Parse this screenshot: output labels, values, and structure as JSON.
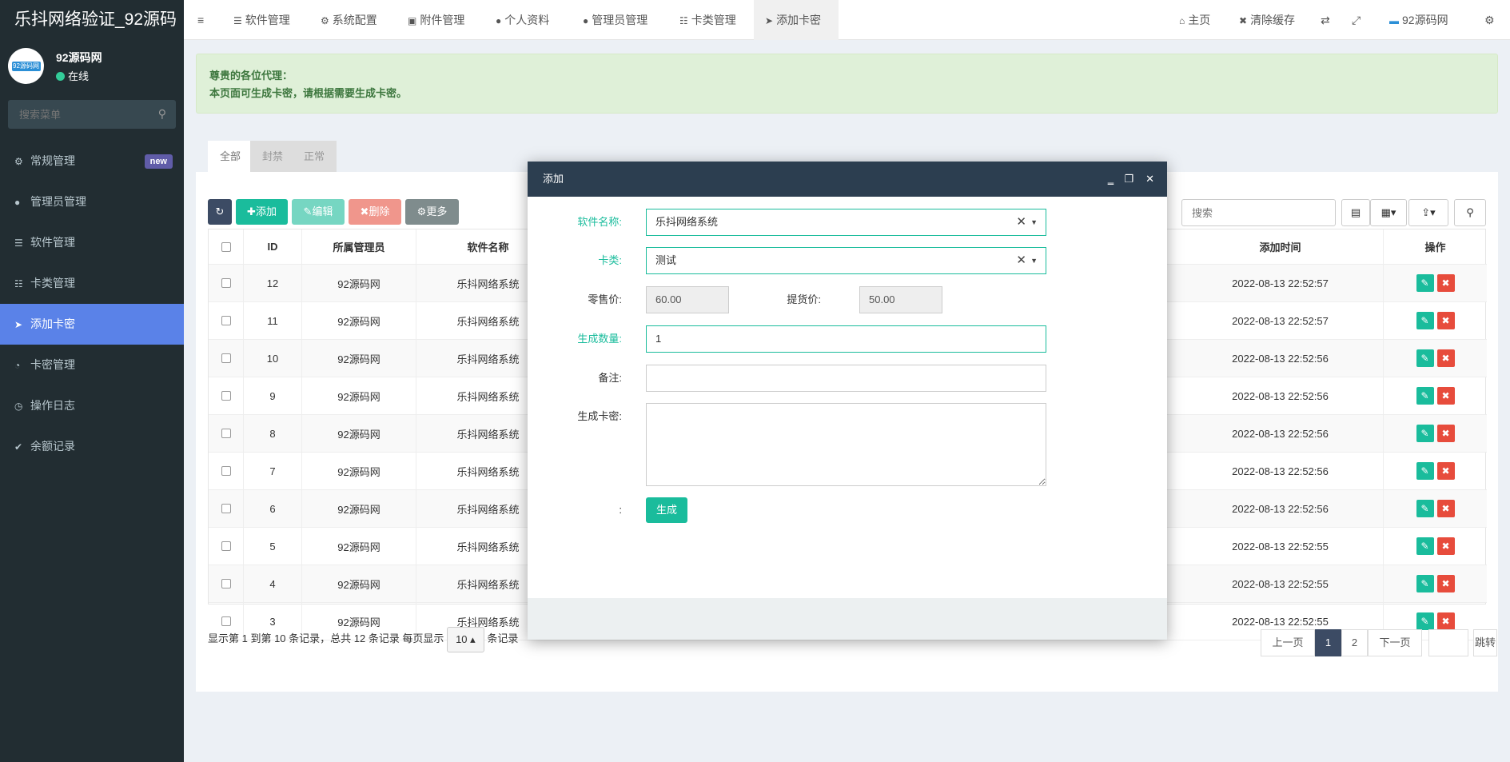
{
  "sidebar": {
    "brand": "乐抖网络验证_92源码",
    "avatar_text": "92源码网",
    "user_name": "92源码网",
    "user_status": "在线",
    "search_placeholder": "搜索菜单",
    "items": [
      {
        "label": "常规管理",
        "icon": "cogs-icon",
        "badge": "new"
      },
      {
        "label": "管理员管理",
        "icon": "user-icon"
      },
      {
        "label": "软件管理",
        "icon": "list-icon"
      },
      {
        "label": "卡类管理",
        "icon": "card-list-icon"
      },
      {
        "label": "添加卡密",
        "icon": "paper-plane-icon",
        "active": true
      },
      {
        "label": "卡密管理",
        "icon": "rss-icon"
      },
      {
        "label": "操作日志",
        "icon": "clock-icon"
      },
      {
        "label": "余额记录",
        "icon": "vimeo-icon"
      }
    ]
  },
  "topbar": {
    "tabs": [
      {
        "label": "软件管理"
      },
      {
        "label": "系统配置"
      },
      {
        "label": "附件管理"
      },
      {
        "label": "个人资料"
      },
      {
        "label": "管理员管理"
      },
      {
        "label": "卡类管理"
      },
      {
        "label": "添加卡密",
        "active": true
      }
    ],
    "home": "主页",
    "clear_cache": "清除缓存",
    "user": "92源码网"
  },
  "notice": {
    "line1": "尊贵的各位代理：",
    "line2": "本页面可生成卡密，请根据需要生成卡密。"
  },
  "panel_tabs": [
    "全部",
    "封禁",
    "正常"
  ],
  "toolbar": {
    "add": "添加",
    "edit": "编辑",
    "delete": "删除",
    "more": "更多",
    "search_placeholder": "搜索"
  },
  "table": {
    "headers": {
      "id": "ID",
      "admin": "所属管理员",
      "software": "软件名称",
      "time": "添加时间",
      "ops": "操作"
    },
    "rows": [
      {
        "id": "12",
        "admin": "92源码网",
        "software": "乐抖网络系统",
        "time": "2022-08-13 22:52:57"
      },
      {
        "id": "11",
        "admin": "92源码网",
        "software": "乐抖网络系统",
        "time": "2022-08-13 22:52:57"
      },
      {
        "id": "10",
        "admin": "92源码网",
        "software": "乐抖网络系统",
        "time": "2022-08-13 22:52:56"
      },
      {
        "id": "9",
        "admin": "92源码网",
        "software": "乐抖网络系统",
        "time": "2022-08-13 22:52:56"
      },
      {
        "id": "8",
        "admin": "92源码网",
        "software": "乐抖网络系统",
        "time": "2022-08-13 22:52:56"
      },
      {
        "id": "7",
        "admin": "92源码网",
        "software": "乐抖网络系统",
        "time": "2022-08-13 22:52:56"
      },
      {
        "id": "6",
        "admin": "92源码网",
        "software": "乐抖网络系统",
        "time": "2022-08-13 22:52:56"
      },
      {
        "id": "5",
        "admin": "92源码网",
        "software": "乐抖网络系统",
        "time": "2022-08-13 22:52:55"
      },
      {
        "id": "4",
        "admin": "92源码网",
        "software": "乐抖网络系统",
        "time": "2022-08-13 22:52:55"
      },
      {
        "id": "3",
        "admin": "92源码网",
        "software": "乐抖网络系统",
        "time": "2022-08-13 22:52:55"
      }
    ]
  },
  "pagination": {
    "info_prefix": "显示第 1 到第 10 条记录，总共 12 条记录 每页显示",
    "page_size": "10",
    "info_suffix": "条记录",
    "prev": "上一页",
    "pages": [
      "1",
      "2"
    ],
    "current": "1",
    "next": "下一页",
    "jump": "跳转"
  },
  "modal": {
    "title": "添加",
    "software_label": "软件名称:",
    "software_value": "乐抖网络系统",
    "cardtype_label": "卡类:",
    "cardtype_value": "测试",
    "retail_label": "零售价:",
    "retail_value": "60.00",
    "pickup_label": "提货价:",
    "pickup_value": "50.00",
    "qty_label": "生成数量:",
    "qty_value": "1",
    "remark_label": "备注:",
    "cards_label": "生成卡密:",
    "submit_label": ":",
    "submit": "生成"
  }
}
